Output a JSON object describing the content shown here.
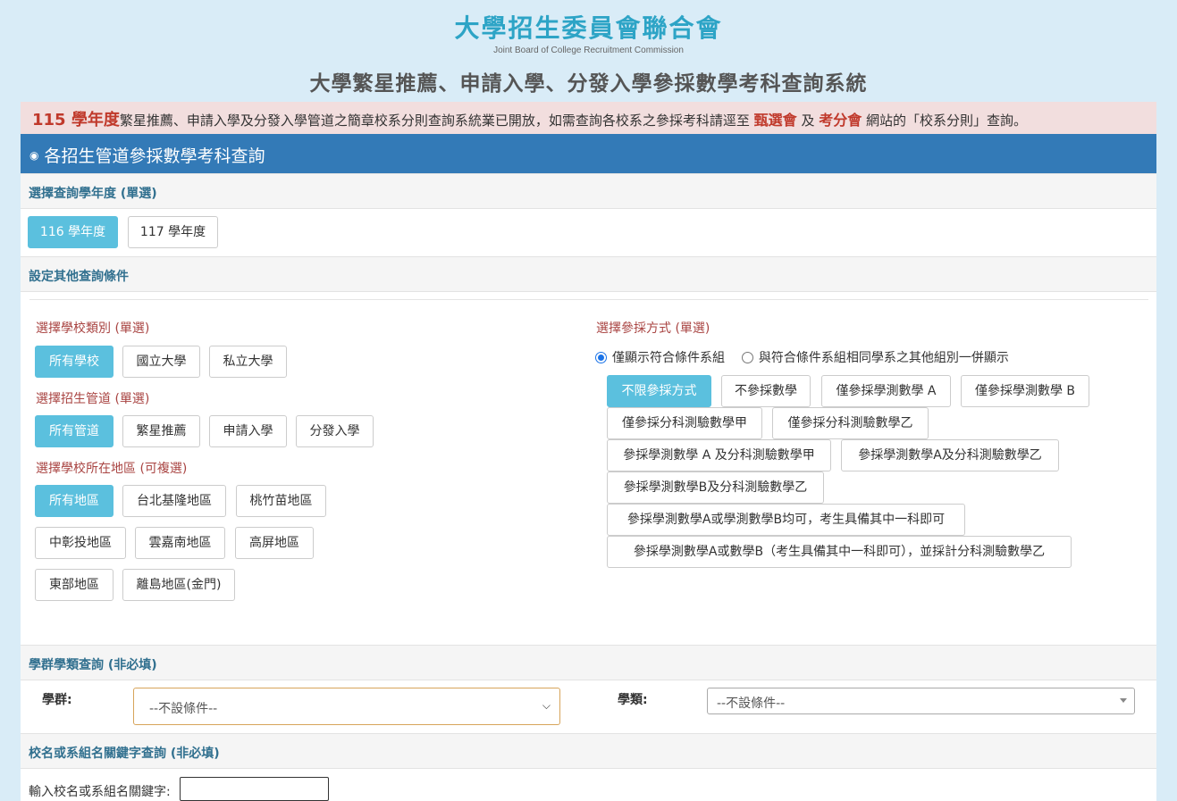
{
  "header": {
    "org_title": "大學招生委員會聯合會",
    "org_subtitle": "Joint Board of College Recruitment Commission",
    "system_title": "大學繁星推薦、申請入學、分發入學參採數學考科查詢系統"
  },
  "notice": {
    "year": "115 學年度",
    "text1": "繁星推薦、申請入學及分發入學管道之簡章校系分則查詢系統業已開放，如需查詢各校系之參採考科請逕至",
    "link1": "甄選會",
    "and": "及",
    "link2": "考分會",
    "text2": "網站的「校系分則」查詢。"
  },
  "panel": {
    "title": "各招生管道參採數學考科查詢",
    "year_section": "選擇查詢學年度 (單選)",
    "years": [
      "116 學年度",
      "117 學年度"
    ],
    "other_section": "設定其他查詢條件",
    "school_type_label": "選擇學校類別 (單選)",
    "school_types": [
      "所有學校",
      "國立大學",
      "私立大學"
    ],
    "channel_label": "選擇招生管道 (單選)",
    "channels": [
      "所有管道",
      "繁星推薦",
      "申請入學",
      "分發入學"
    ],
    "region_label": "選擇學校所在地區 (可複選)",
    "regions": [
      "所有地區",
      "台北基隆地區",
      "桃竹苗地區",
      "中彰投地區",
      "雲嘉南地區",
      "高屏地區",
      "東部地區",
      "離島地區(金門)"
    ],
    "method_label": "選擇參採方式 (單選)",
    "radio1": "僅顯示符合條件系組",
    "radio2": "與符合條件系組相同學系之其他組別一併顯示",
    "methods": [
      "不限參採方式",
      "不參採數學",
      "僅參採學測數學 A",
      "僅參採學測數學 B",
      "僅參採分科測驗數學甲",
      "僅參採分科測驗數學乙",
      "參採學測數學 A 及分科測驗數學甲",
      "參採學測數學A及分科測驗數學乙",
      "參採學測數學B及分科測驗數學乙",
      "參採學測數學A或學測數學B均可，考生具備其中一科即可",
      "參採學測數學A或數學B（考生具備其中一科即可），並採計分科測驗數學乙"
    ],
    "group_section": "學群學類查詢 (非必填)",
    "group_label": "學群:",
    "group_value": "--不設條件--",
    "category_label": "學類:",
    "category_value": "--不設條件--",
    "keyword_section": "校名或系組名關鍵字查詢 (非必填)",
    "keyword_label": "輸入校名或系組名關鍵字:",
    "keyword_value": ""
  },
  "colors": {
    "background": "#d9ecf7",
    "title_accent": "#2da4c6",
    "panel_header": "#337ab7",
    "active_button": "#5bc0de",
    "label_red": "#a94442",
    "notice_bg": "#f2dede"
  }
}
